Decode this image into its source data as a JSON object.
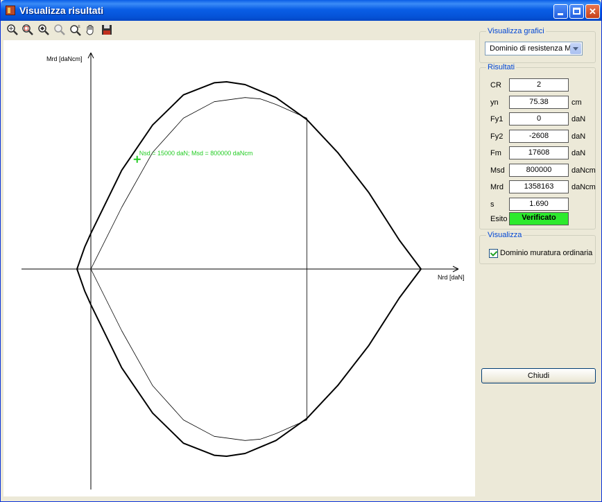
{
  "window": {
    "title": "Visualizza risultati",
    "icon": "app-icon",
    "controls": [
      "minimize-icon",
      "maximize-icon",
      "close-icon"
    ]
  },
  "toolbar": {
    "tools": [
      "zoom-in-icon",
      "zoom-window-icon",
      "zoom-extents-icon",
      "zoom-previous-icon",
      "zoom-realtime-icon",
      "pan-hand-icon",
      "save-icon"
    ]
  },
  "chart_data": {
    "type": "line",
    "xlabel": "Nrd [daN]",
    "ylabel": "Mrd [daNcm]",
    "annotation": {
      "text": "Nsd = 15000 daN; Msd = 800000 daNcm",
      "x": 15000,
      "y": 800000,
      "color": "#22cc22"
    },
    "series": [
      {
        "style": "thick",
        "x": [
          -4500,
          -2000,
          0,
          10000,
          20000,
          30000,
          40000,
          44000,
          50000,
          60000,
          70000,
          80000,
          90000,
          100000,
          107000,
          100000,
          90000,
          80000,
          70000,
          60000,
          50000,
          44000,
          40000,
          30000,
          20000,
          10000,
          0,
          -2000,
          -4500
        ],
        "y": [
          0,
          160000,
          260000,
          720000,
          1050000,
          1270000,
          1358163,
          1365000,
          1345000,
          1250000,
          1090000,
          850000,
          560000,
          210000,
          0,
          -210000,
          -560000,
          -850000,
          -1090000,
          -1250000,
          -1345000,
          -1365000,
          -1358163,
          -1270000,
          -1050000,
          -720000,
          -260000,
          -160000,
          0
        ]
      },
      {
        "style": "thin",
        "x": [
          0,
          10000,
          20000,
          30000,
          40000,
          50000,
          55000,
          60000,
          70000,
          70000,
          60000,
          55000,
          50000,
          40000,
          30000,
          20000,
          10000,
          0
        ],
        "y": [
          0,
          450000,
          850000,
          1100000,
          1220000,
          1250000,
          1240000,
          1200000,
          1100000,
          -1100000,
          -1200000,
          -1240000,
          -1250000,
          -1220000,
          -1100000,
          -850000,
          -450000,
          0
        ]
      }
    ]
  },
  "panel": {
    "graphs_group": {
      "title": "Visualizza grafici",
      "selected": "Dominio di resistenza M-N"
    },
    "results_group": {
      "title": "Risultati",
      "rows": [
        {
          "label": "CR",
          "value": "2",
          "unit": ""
        },
        {
          "label": "yn",
          "value": "75.38",
          "unit": "cm"
        },
        {
          "label": "Fy1",
          "value": "0",
          "unit": "daN"
        },
        {
          "label": "Fy2",
          "value": "-2608",
          "unit": "daN"
        },
        {
          "label": "Fm",
          "value": "17608",
          "unit": "daN"
        },
        {
          "label": "Msd",
          "value": "800000",
          "unit": "daNcm"
        },
        {
          "label": "Mrd",
          "value": "1358163",
          "unit": "daNcm"
        },
        {
          "label": "s",
          "value": "1.690",
          "unit": ""
        }
      ],
      "esito_label": "Esito",
      "esito_value": "Verificato",
      "esito_color": "#2dea2d"
    },
    "view_group": {
      "title": "Visualizza",
      "checkbox_label": "Dominio muratura ordinaria",
      "checked": true
    },
    "close_button": "Chiudi"
  }
}
